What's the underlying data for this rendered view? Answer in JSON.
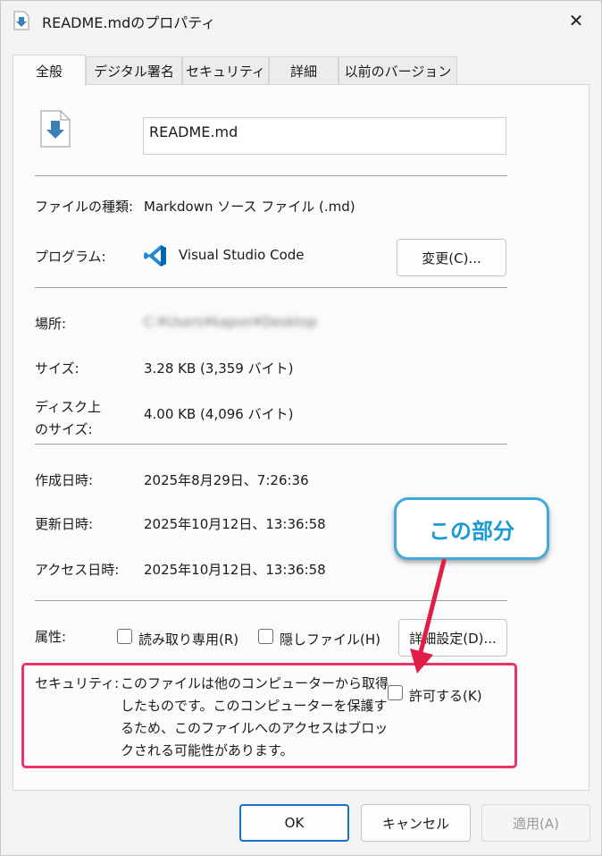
{
  "window": {
    "title": "README.mdのプロパティ"
  },
  "tabs": [
    "全般",
    "デジタル署名",
    "セキュリティ",
    "詳細",
    "以前のバージョン"
  ],
  "general": {
    "filename": "README.md",
    "file_type_label": "ファイルの種類:",
    "file_type_value": "Markdown ソース ファイル (.md)",
    "program_label": "プログラム:",
    "program_value": "Visual Studio Code",
    "change_button": "変更(C)...",
    "location_label": "場所:",
    "location_value": "C:¥Users¥kapon¥Desktop",
    "size_label": "サイズ:",
    "size_value": "3.28 KB (3,359 バイト)",
    "disk_size_label_1": "ディスク上",
    "disk_size_label_2": "のサイズ:",
    "disk_size_value": "4.00 KB (4,096 バイト)",
    "created_label": "作成日時:",
    "created_value": "2025年8月29日、7:26:36",
    "modified_label": "更新日時:",
    "modified_value": "2025年10月12日、13:36:58",
    "accessed_label": "アクセス日時:",
    "accessed_value": "2025年10月12日、13:36:58",
    "attributes_label": "属性:",
    "readonly_label": "読み取り専用(R)",
    "hidden_label": "隠しファイル(H)",
    "advanced_button": "詳細設定(D)...",
    "security_label": "セキュリティ:",
    "security_text_1": "このファイルは他のコンピューターから取得",
    "security_text_2": "したものです。このコンピューターを保護す",
    "security_text_3": "るため、このファイルへのアクセスはブロッ",
    "security_text_4": "クされる可能性があります。",
    "unblock_label": "許可する(K)"
  },
  "annotation": {
    "callout_text": "この部分",
    "highlight_color": "#e8356a",
    "callout_color": "#1c9ad4"
  },
  "footer": {
    "ok": "OK",
    "cancel": "キャンセル",
    "apply": "適用(A)"
  },
  "icons": {
    "file": "file-download-icon",
    "program": "vscode-icon",
    "close": "close-icon"
  }
}
